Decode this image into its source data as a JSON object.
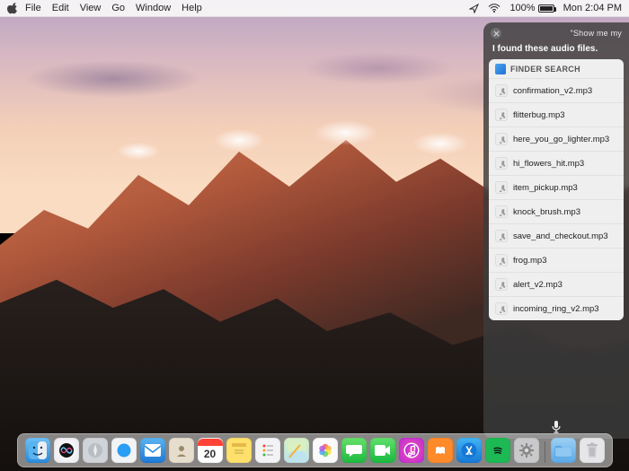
{
  "menubar": {
    "items": [
      "File",
      "Edit",
      "View",
      "Go",
      "Window",
      "Help"
    ],
    "battery_pct": "100%",
    "clock": "Mon 2:04 PM"
  },
  "siri": {
    "hint": "\"Show me my",
    "title": "I found these audio files.",
    "section_header": "FINDER SEARCH",
    "files": [
      "confirmation_v2.mp3",
      "flitterbug.mp3",
      "here_you_go_lighter.mp3",
      "hi_flowers_hit.mp3",
      "item_pickup.mp3",
      "knock_brush.mp3",
      "save_and_checkout.mp3",
      "frog.mp3",
      "alert_v2.mp3",
      "incoming_ring_v2.mp3"
    ]
  },
  "dock": {
    "calendar_day": "20",
    "tiles": [
      {
        "name": "finder",
        "label": "Finder"
      },
      {
        "name": "siri",
        "label": "Siri"
      },
      {
        "name": "launchpad",
        "label": "Launchpad"
      },
      {
        "name": "safari",
        "label": "Safari"
      },
      {
        "name": "mail",
        "label": "Mail"
      },
      {
        "name": "contacts",
        "label": "Contacts"
      },
      {
        "name": "calendar",
        "label": "Calendar"
      },
      {
        "name": "notes",
        "label": "Notes"
      },
      {
        "name": "reminders",
        "label": "Reminders"
      },
      {
        "name": "maps",
        "label": "Maps"
      },
      {
        "name": "photos",
        "label": "Photos"
      },
      {
        "name": "messages",
        "label": "Messages"
      },
      {
        "name": "facetime",
        "label": "FaceTime"
      },
      {
        "name": "itunes",
        "label": "iTunes"
      },
      {
        "name": "ibooks",
        "label": "iBooks"
      },
      {
        "name": "appstore",
        "label": "App Store"
      },
      {
        "name": "spotify",
        "label": "Spotify"
      },
      {
        "name": "sysprefs",
        "label": "System Preferences"
      }
    ]
  },
  "colors": {
    "panel_bg": "#3c3c3ccc",
    "card_bg": "#efefef"
  }
}
